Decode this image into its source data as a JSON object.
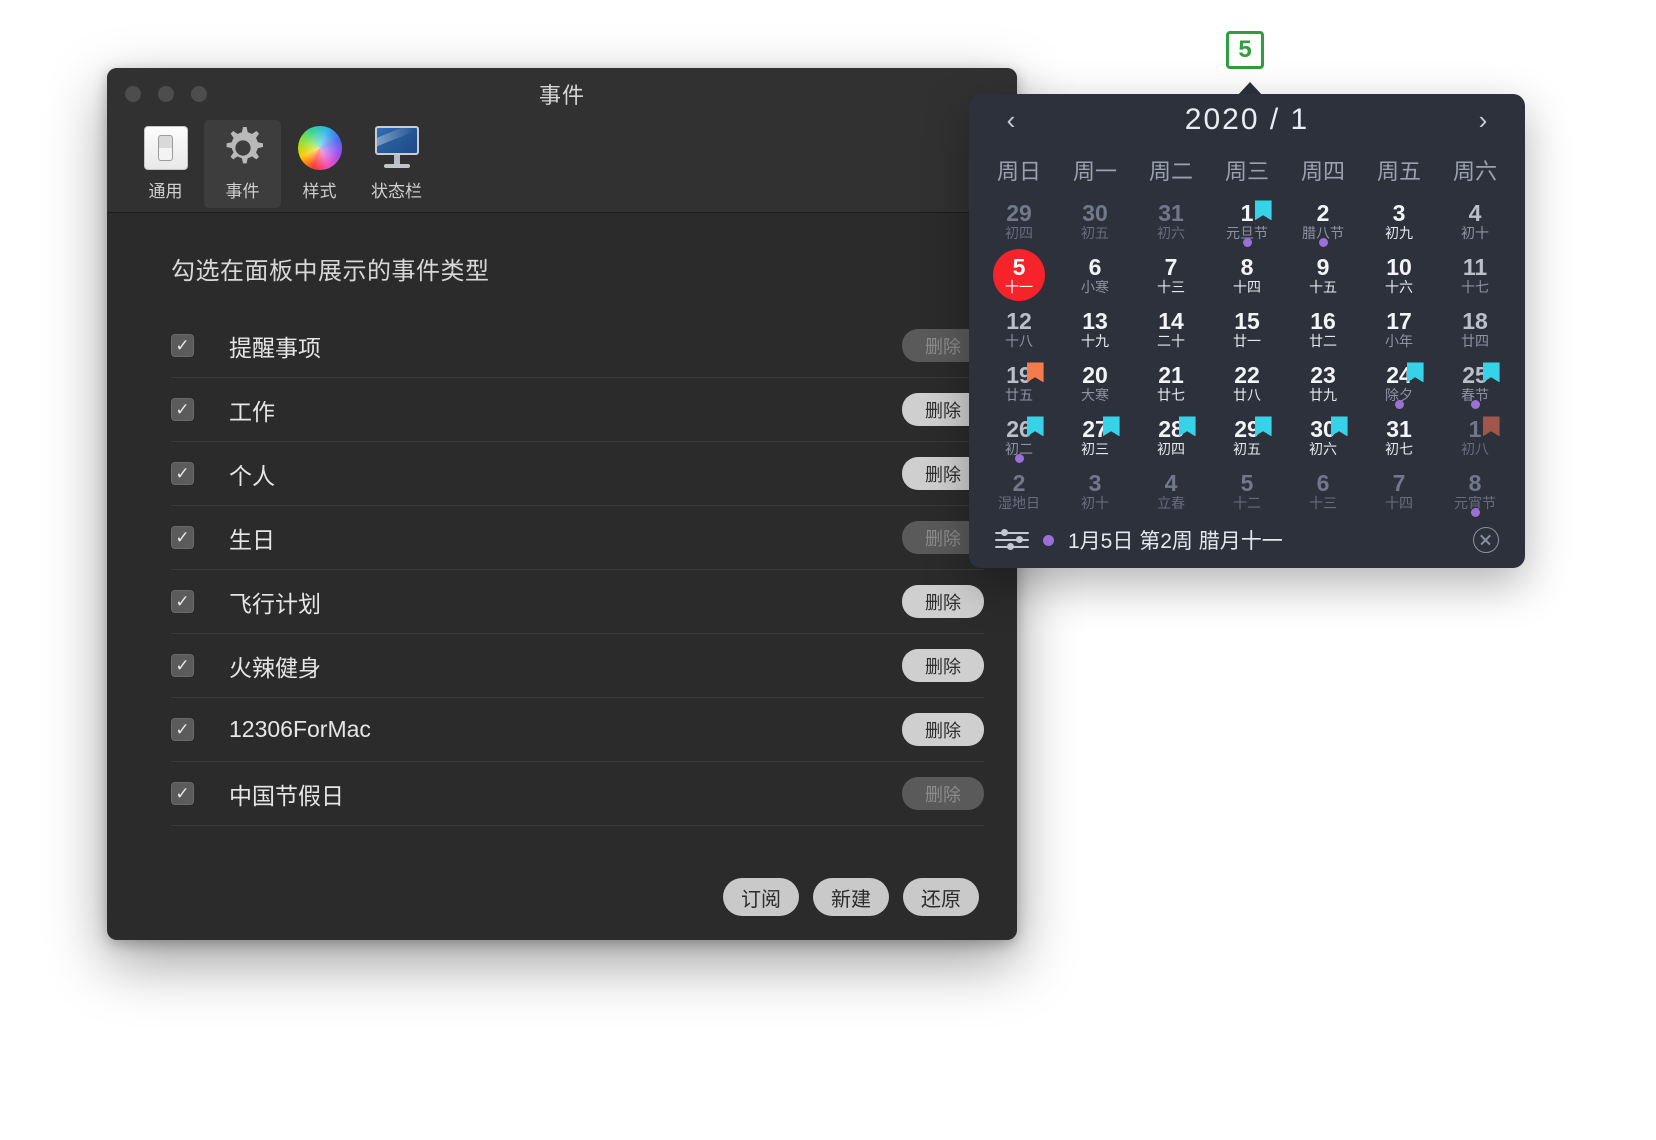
{
  "prefs_window": {
    "title": "事件",
    "traffic_lights": [
      "close-button",
      "minimize-button",
      "zoom-button"
    ],
    "toolbar": [
      {
        "label": "通用",
        "icon": "toggle-switch-icon",
        "active": false
      },
      {
        "label": "事件",
        "icon": "gear-icon",
        "active": true
      },
      {
        "label": "样式",
        "icon": "color-wheel-icon",
        "active": false
      },
      {
        "label": "状态栏",
        "icon": "monitor-icon",
        "active": false
      }
    ],
    "prompt": "勾选在面板中展示的事件类型",
    "delete_label": "删除",
    "rows": [
      {
        "label": "提醒事项",
        "checked": true,
        "delete_enabled": false
      },
      {
        "label": "工作",
        "checked": true,
        "delete_enabled": true
      },
      {
        "label": "个人",
        "checked": true,
        "delete_enabled": true
      },
      {
        "label": "生日",
        "checked": true,
        "delete_enabled": false
      },
      {
        "label": "飞行计划",
        "checked": true,
        "delete_enabled": true
      },
      {
        "label": "火辣健身",
        "checked": true,
        "delete_enabled": true
      },
      {
        "label": "12306ForMac",
        "checked": true,
        "delete_enabled": true
      },
      {
        "label": "中国节假日",
        "checked": true,
        "delete_enabled": false
      }
    ],
    "footer_buttons": [
      {
        "label": "订阅"
      },
      {
        "label": "新建"
      },
      {
        "label": "还原"
      }
    ]
  },
  "menubar_badge": {
    "text": "5",
    "border_color": "#2e9e3f",
    "text_color": "#2e9e3f"
  },
  "calendar": {
    "prev_label": "‹",
    "next_label": "›",
    "title": "2020 / 1",
    "weekdays": [
      "周日",
      "周一",
      "周二",
      "周三",
      "周四",
      "周五",
      "周六"
    ],
    "colors": {
      "panel_bg": "#2d313c",
      "today_bg": "#f7232a",
      "flag_cyan": "#35d2e8",
      "flag_orange": "#f47c4a",
      "flag_brown": "#a0574a",
      "dot_purple": "#9b6fd6"
    },
    "days": [
      {
        "d": "29",
        "l": "初四",
        "out": true
      },
      {
        "d": "30",
        "l": "初五",
        "out": true
      },
      {
        "d": "31",
        "l": "初六",
        "out": true
      },
      {
        "d": "1",
        "l": "元旦节",
        "dim_lunar": true,
        "flag": "cyan",
        "dot": true
      },
      {
        "d": "2",
        "l": "腊八节",
        "dim_lunar": true,
        "dot": true
      },
      {
        "d": "3",
        "l": "初九"
      },
      {
        "d": "4",
        "l": "初十",
        "dim": true,
        "dim_lunar": true
      },
      {
        "d": "5",
        "l": "十一",
        "today": true
      },
      {
        "d": "6",
        "l": "小寒",
        "dim_lunar": true
      },
      {
        "d": "7",
        "l": "十三"
      },
      {
        "d": "8",
        "l": "十四"
      },
      {
        "d": "9",
        "l": "十五"
      },
      {
        "d": "10",
        "l": "十六"
      },
      {
        "d": "11",
        "l": "十七",
        "dim": true,
        "dim_lunar": true
      },
      {
        "d": "12",
        "l": "十八",
        "dim": true,
        "dim_lunar": true
      },
      {
        "d": "13",
        "l": "十九"
      },
      {
        "d": "14",
        "l": "二十"
      },
      {
        "d": "15",
        "l": "廿一"
      },
      {
        "d": "16",
        "l": "廿二"
      },
      {
        "d": "17",
        "l": "小年",
        "dim_lunar": true
      },
      {
        "d": "18",
        "l": "廿四",
        "dim": true,
        "dim_lunar": true
      },
      {
        "d": "19",
        "l": "廿五",
        "dim": true,
        "dim_lunar": true,
        "flag": "orange"
      },
      {
        "d": "20",
        "l": "大寒",
        "dim_lunar": true
      },
      {
        "d": "21",
        "l": "廿七"
      },
      {
        "d": "22",
        "l": "廿八"
      },
      {
        "d": "23",
        "l": "廿九"
      },
      {
        "d": "24",
        "l": "除夕",
        "dim_lunar": true,
        "flag": "cyan",
        "dot": true
      },
      {
        "d": "25",
        "l": "春节",
        "dim": true,
        "dim_lunar": true,
        "flag": "cyan",
        "dot": true
      },
      {
        "d": "26",
        "l": "初二",
        "dim": true,
        "dim_lunar": true,
        "flag": "cyan",
        "dot": true
      },
      {
        "d": "27",
        "l": "初三",
        "flag": "cyan"
      },
      {
        "d": "28",
        "l": "初四",
        "flag": "cyan"
      },
      {
        "d": "29",
        "l": "初五",
        "flag": "cyan"
      },
      {
        "d": "30",
        "l": "初六",
        "flag": "cyan"
      },
      {
        "d": "31",
        "l": "初七"
      },
      {
        "d": "1",
        "l": "初八",
        "out": true,
        "flag": "brown"
      },
      {
        "d": "2",
        "l": "湿地日",
        "out": true
      },
      {
        "d": "3",
        "l": "初十",
        "out": true
      },
      {
        "d": "4",
        "l": "立春",
        "out": true
      },
      {
        "d": "5",
        "l": "十二",
        "out": true
      },
      {
        "d": "6",
        "l": "十三",
        "out": true
      },
      {
        "d": "7",
        "l": "十四",
        "out": true
      },
      {
        "d": "8",
        "l": "元宵节",
        "out": true,
        "dot": true
      }
    ],
    "footer": {
      "settings_icon": "sliders-icon",
      "status_text": "1月5日 第2周 腊月十一",
      "close_icon": "close-circle-icon"
    }
  }
}
